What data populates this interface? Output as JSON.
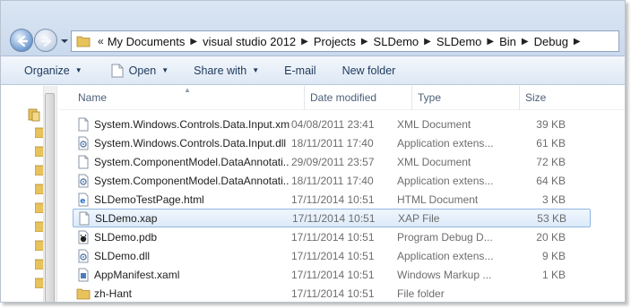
{
  "address_bar": {
    "overflow_label": "«",
    "crumbs": [
      "My Documents",
      "visual studio 2012",
      "Projects",
      "SLDemo",
      "SLDemo",
      "Bin",
      "Debug"
    ]
  },
  "toolbar": {
    "organize": "Organize",
    "open": "Open",
    "share_with": "Share with",
    "email": "E-mail",
    "new_folder": "New folder"
  },
  "columns": {
    "name": "Name",
    "date_modified": "Date modified",
    "type": "Type",
    "size": "Size"
  },
  "files": [
    {
      "name": "System.Windows.Controls.Data.Input.xml",
      "date": "04/08/2011 23:41",
      "type": "XML Document",
      "size": "39 KB",
      "icon": "xml-file-icon"
    },
    {
      "name": "System.Windows.Controls.Data.Input.dll",
      "date": "18/11/2011 17:40",
      "type": "Application extens...",
      "size": "61 KB",
      "icon": "dll-file-icon"
    },
    {
      "name": "System.ComponentModel.DataAnnotati...",
      "date": "29/09/2011 23:57",
      "type": "XML Document",
      "size": "72 KB",
      "icon": "xml-file-icon"
    },
    {
      "name": "System.ComponentModel.DataAnnotati...",
      "date": "18/11/2011 17:40",
      "type": "Application extens...",
      "size": "64 KB",
      "icon": "dll-file-icon"
    },
    {
      "name": "SLDemoTestPage.html",
      "date": "17/11/2014 10:51",
      "type": "HTML Document",
      "size": "3 KB",
      "icon": "html-file-icon"
    },
    {
      "name": "SLDemo.xap",
      "date": "17/11/2014 10:51",
      "type": "XAP File",
      "size": "53 KB",
      "icon": "xap-file-icon"
    },
    {
      "name": "SLDemo.pdb",
      "date": "17/11/2014 10:51",
      "type": "Program Debug D...",
      "size": "20 KB",
      "icon": "pdb-file-icon"
    },
    {
      "name": "SLDemo.dll",
      "date": "17/11/2014 10:51",
      "type": "Application extens...",
      "size": "9 KB",
      "icon": "dll-file-icon"
    },
    {
      "name": "AppManifest.xaml",
      "date": "17/11/2014 10:51",
      "type": "Windows Markup ...",
      "size": "1 KB",
      "icon": "xaml-file-icon"
    },
    {
      "name": "zh-Hant",
      "date": "17/11/2014 10:51",
      "type": "File folder",
      "size": "",
      "icon": "folder-icon"
    }
  ],
  "selected_file": "SLDemo.xap",
  "colors": {
    "selection_border": "#8fb7e3",
    "selection_fill": "#dceaf9",
    "toolbar_text": "#1e395b",
    "folder": "#e8c25a"
  }
}
